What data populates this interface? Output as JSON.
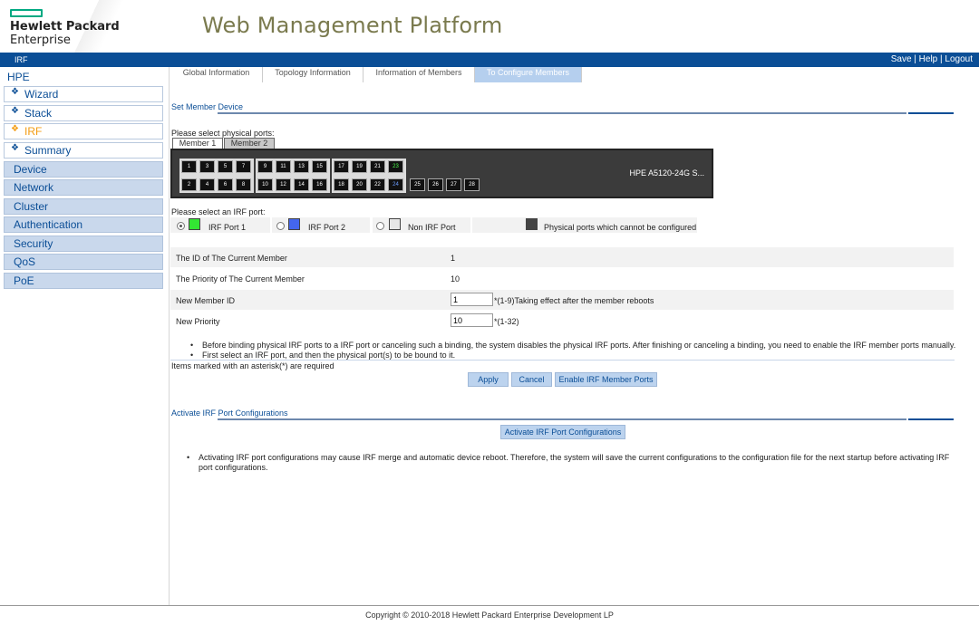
{
  "header": {
    "logo_line1": "Hewlett Packard",
    "logo_line2": "Enterprise",
    "title": "Web Management Platform"
  },
  "topbar": {
    "breadcrumb": "IRF",
    "save": "Save",
    "sep1": " | ",
    "help": "Help",
    "sep2": " | ",
    "logout": "Logout"
  },
  "sidebar": {
    "root": "HPE",
    "items": [
      {
        "label": "Wizard",
        "icon": "diamond-icon"
      },
      {
        "label": "Stack",
        "icon": "diamond-icon"
      },
      {
        "label": "IRF",
        "icon": "diamond-icon",
        "active": true
      },
      {
        "label": "Summary",
        "icon": "diamond-icon"
      }
    ],
    "categories": [
      "Device",
      "Network",
      "Cluster",
      "Authentication",
      "Security",
      "QoS",
      "PoE"
    ]
  },
  "tabs": [
    {
      "label": "Global Information"
    },
    {
      "label": "Topology Information"
    },
    {
      "label": "Information of Members"
    },
    {
      "label": "To Configure Members",
      "active": true
    }
  ],
  "set_member": {
    "section_title": "Set Member Device",
    "select_ports_label": "Please select physical ports:",
    "member_tabs": [
      "Member 1",
      "Member 2"
    ],
    "switch_model": "HPE A5120-24G S...",
    "ports_top": [
      "1",
      "3",
      "5",
      "7",
      "9",
      "11",
      "13",
      "15",
      "17",
      "19",
      "21",
      "23"
    ],
    "ports_bottom": [
      "2",
      "4",
      "6",
      "8",
      "10",
      "12",
      "14",
      "16",
      "18",
      "20",
      "22",
      "24"
    ],
    "ports_extra": [
      "25",
      "26",
      "27",
      "28"
    ],
    "port_23_state": "irf-port-1",
    "port_24_state": "irf-port-2",
    "select_irf_label": "Please select an IRF port:",
    "legend": {
      "irf1": "IRF Port 1",
      "irf2": "IRF Port 2",
      "non": "Non IRF Port",
      "locked": "Physical ports which cannot be configured",
      "selected": "irf1",
      "colors": {
        "irf1": "#33e633",
        "irf2": "#4466ee",
        "non": "#e6e6e6",
        "locked": "#444444"
      }
    },
    "fields": {
      "current_id_label": "The ID of The Current Member",
      "current_id_value": "1",
      "current_priority_label": "The Priority of The Current Member",
      "current_priority_value": "10",
      "new_id_label": "New Member ID",
      "new_id_value": "1",
      "new_id_hint": "*(1-9)Taking effect after the member reboots",
      "new_priority_label": "New Priority",
      "new_priority_value": "10",
      "new_priority_hint": "*(1-32)"
    },
    "notes": [
      "Before binding physical IRF ports to a IRF port or canceling such a binding, the system disables the physical IRF ports. After finishing or canceling a binding, you need to enable the IRF member ports manually.",
      "First select an IRF port, and then the physical port(s) to be bound to it."
    ],
    "required_note": "Items marked with an asterisk(*) are required",
    "buttons": {
      "apply": "Apply",
      "cancel": "Cancel",
      "enable": "Enable IRF Member Ports"
    }
  },
  "activate": {
    "section_title": "Activate IRF Port Configurations",
    "button": "Activate IRF Port Configurations",
    "note": "Activating IRF port configurations may cause IRF merge and automatic device reboot. Therefore, the system will save the current configurations to the configuration file for the next startup before activating IRF port configurations."
  },
  "footer": "Copyright © 2010-2018 Hewlett Packard Enterprise Development LP"
}
